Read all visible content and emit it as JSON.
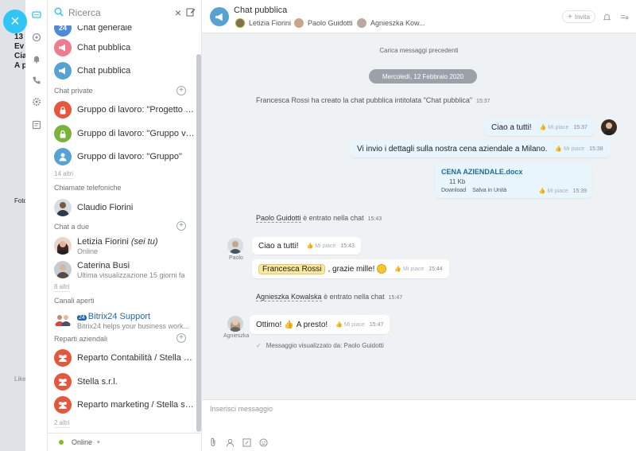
{
  "background_fragments": [
    "13",
    "Ev",
    "Cia",
    "A p",
    "Foto",
    "Like"
  ],
  "search": {
    "placeholder": "Ricerca"
  },
  "recent": {
    "top_items": [
      {
        "name": "Chat generale",
        "color": "#4f8ad8"
      },
      {
        "name": "Chat pubblica",
        "color": "#f17a8f"
      },
      {
        "name": "Chat pubblica",
        "color": "#56a3d3"
      }
    ],
    "private": {
      "label": "Chat private",
      "items": [
        {
          "name": "Gruppo di lavoro: \"Progetto pu...",
          "color": "#e8553a"
        },
        {
          "name": "Gruppo di lavoro: \"Gruppo ven...",
          "color": "#7bb239"
        },
        {
          "name": "Gruppo di lavoro: \"Gruppo\"",
          "color": "#56a3d3"
        }
      ],
      "more": "14 altri"
    },
    "calls": {
      "label": "Chiamate telefoniche",
      "items": [
        {
          "name": "Claudio Fiorini"
        }
      ]
    },
    "direct": {
      "label": "Chat a due",
      "items": [
        {
          "name": "Letizia Fiorini",
          "self": "(sei tu)",
          "sub": "Online"
        },
        {
          "name": "Caterina Busi",
          "sub": "Ultima visualizzazione 15 giorni fa"
        }
      ],
      "more": "8 altri"
    },
    "open": {
      "label": "Canali aperti",
      "items": [
        {
          "name": "Bitrix24 Support",
          "sub": "Bitrix24 helps your business work..."
        }
      ]
    },
    "depts": {
      "label": "Reparti aziendali",
      "items": [
        {
          "name": "Reparto Contabilità / Stella s.r.l."
        },
        {
          "name": "Stella s.r.l."
        },
        {
          "name": "Reparto marketing / Stella s.r.l."
        }
      ],
      "more": "2 altri"
    },
    "status": "Online"
  },
  "chat": {
    "title": "Chat pubblica",
    "members": [
      "Letizia Fiorini",
      "Paolo Guidotti",
      "Agnieszka Kow..."
    ],
    "invite": "Invita",
    "load_previous": "Carica messaggi precedenti",
    "date": "Mercoledì, 12 Febbraio 2020",
    "like": "Mi piace",
    "created": {
      "text": "Francesca Rossi ha creato la chat pubblica intitolata \"Chat pubblica\"",
      "time": "15:37"
    },
    "out_messages": [
      {
        "text": "Ciao a tutti!",
        "time": "15:37"
      },
      {
        "text": "Vi invio i dettagli sulla nostra cena aziendale a Milano.",
        "time": "15:38"
      }
    ],
    "file": {
      "name": "CENA AZIENDALE.docx",
      "size": "11 Kb",
      "download": "Download",
      "save": "Salva in Unità",
      "time": "15:39"
    },
    "join1": {
      "user": "Paolo Guidotti",
      "text": "è entrato nella chat",
      "time": "15:43"
    },
    "paolo": {
      "name": "Paolo",
      "messages": [
        {
          "text": "Ciao a tutti!",
          "time": "15:43"
        },
        {
          "mention": "Francesca Rossi",
          "text": ", grazie mille!",
          "time": "15:44"
        }
      ]
    },
    "join2": {
      "user": "Agnieszka Kowalska",
      "text": "è entrato nella chat",
      "time": "15:47"
    },
    "agnieszka": {
      "name": "Agnieszka",
      "text1": "Ottimo!",
      "text2": "A presto!",
      "time": "15:47"
    },
    "seen": "Messaggio visualizzato da: Paolo Guidotti",
    "input_placeholder": "Inserisci messaggio"
  }
}
